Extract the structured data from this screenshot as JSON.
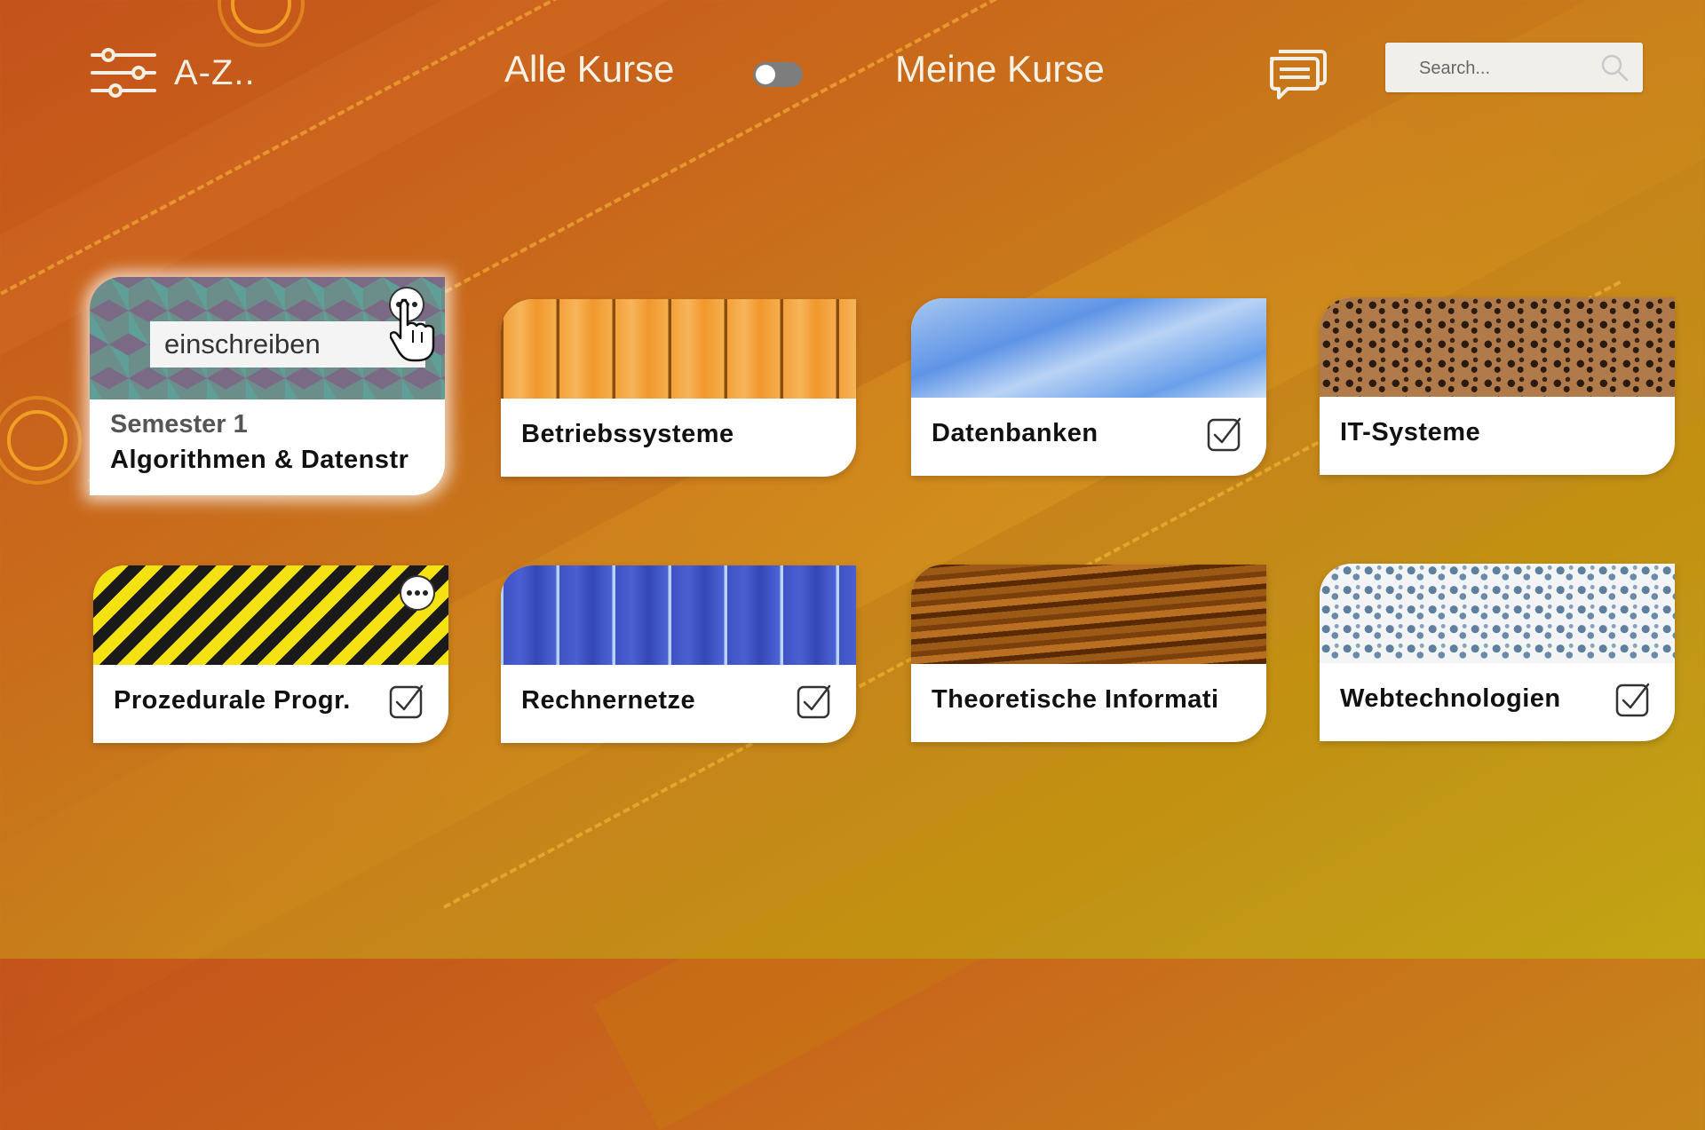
{
  "header": {
    "filter_label": "A-Z..",
    "nav_all": "Alle Kurse",
    "nav_mine": "Meine Kurse",
    "toggle_state": "off",
    "search_placeholder": "Search..."
  },
  "courses": [
    {
      "semester": "Semester 1",
      "title": "Algorithmen & Datenstr",
      "enroll_label": "einschreiben",
      "texture": "teal-cubes",
      "checked": false,
      "more": true,
      "active": true
    },
    {
      "title": "Betriebssysteme",
      "texture": "orange-wood",
      "checked": false
    },
    {
      "title": "Datenbanken",
      "texture": "blue-sky",
      "checked": true
    },
    {
      "title": "IT-Systeme",
      "texture": "leopard",
      "checked": false
    },
    {
      "title": "Prozedurale Progr.",
      "texture": "hazard-stripes",
      "checked": true,
      "more": true
    },
    {
      "title": "Rechnernetze",
      "texture": "blue-wood",
      "checked": true
    },
    {
      "title": "Theoretische Informati",
      "texture": "brown-fur",
      "checked": false
    },
    {
      "title": "Webtechnologien",
      "texture": "snow-leopard",
      "checked": true
    }
  ],
  "colors": {
    "background_start": "#c4521a",
    "background_end": "#c3a514",
    "card": "#ffffff",
    "title_text": "#111111"
  }
}
